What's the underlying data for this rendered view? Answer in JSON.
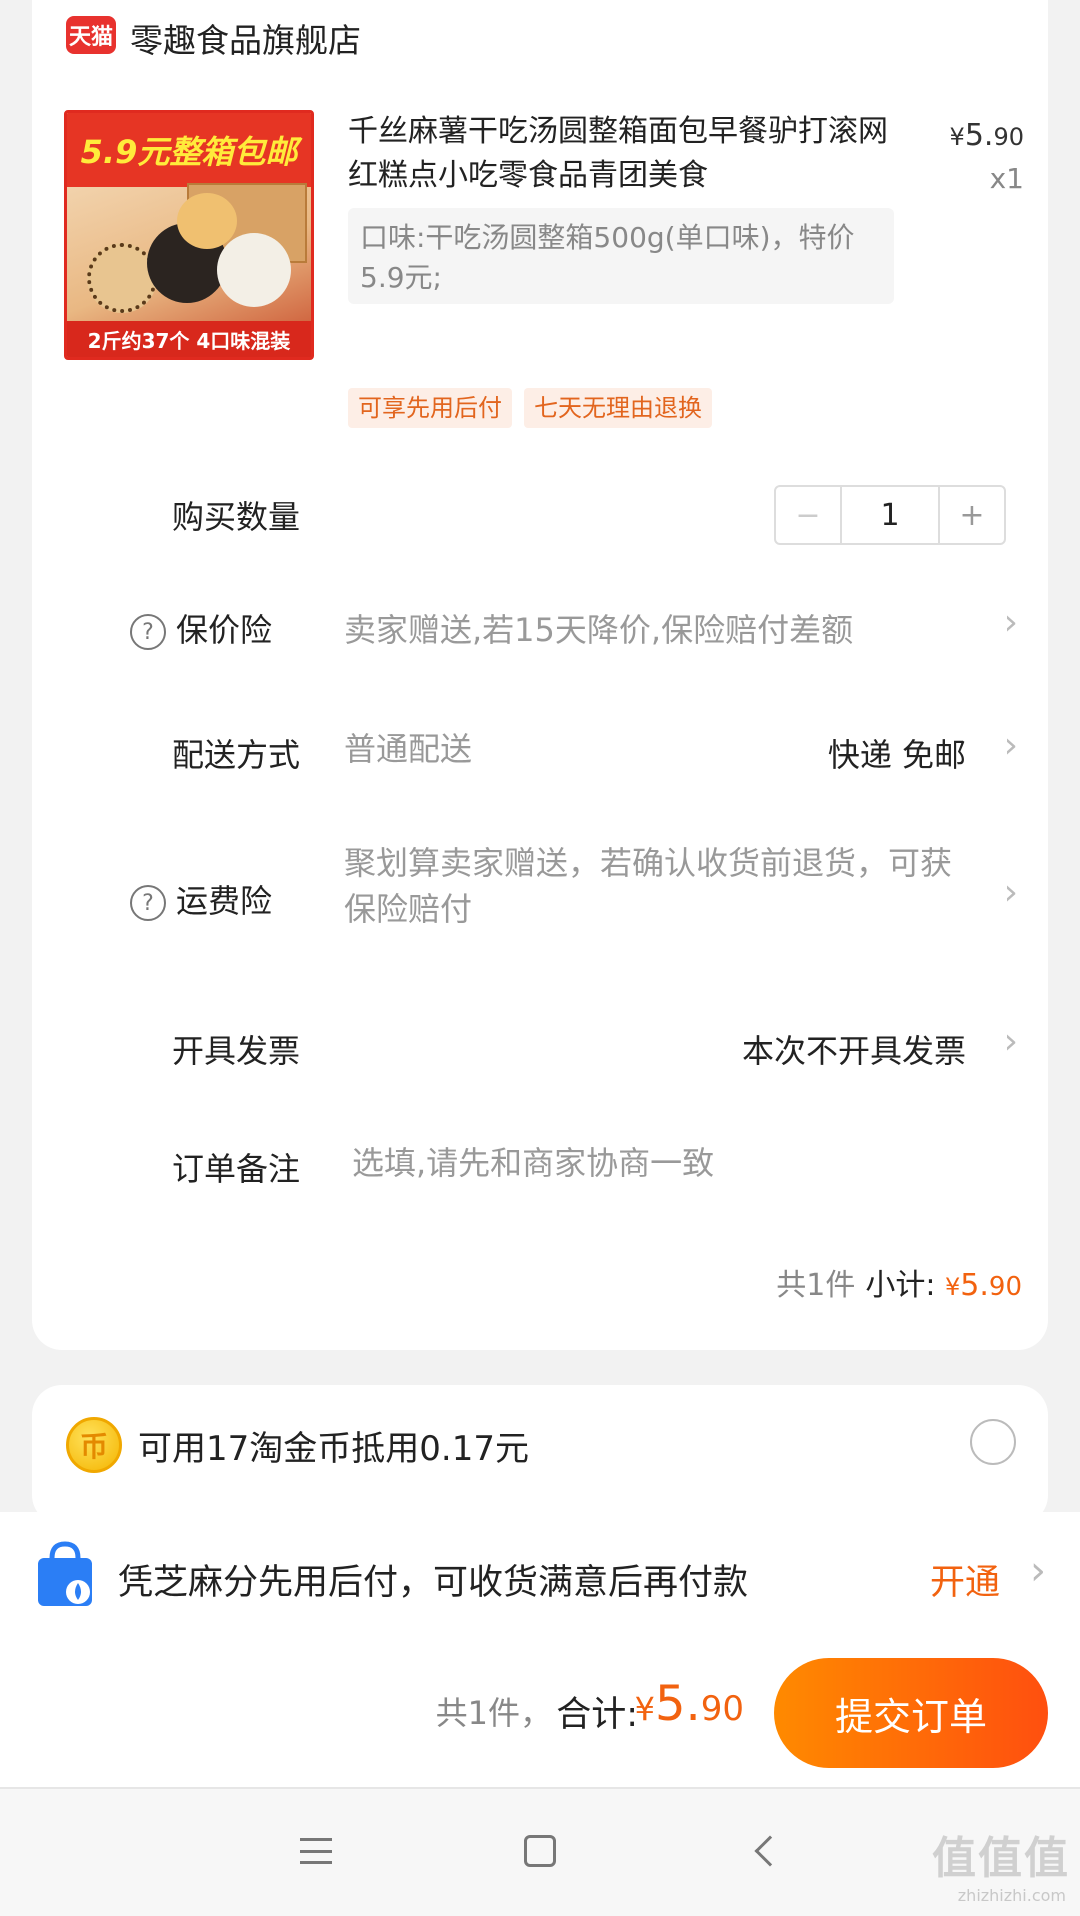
{
  "store": {
    "logo_text": "天猫",
    "name": "零趣食品旗舰店"
  },
  "product": {
    "image_banner": "5.9元整箱包邮",
    "image_footer": "2斤约37个 4口味混装",
    "title": "千丝麻薯干吃汤圆整箱面包早餐驴打滚网红糕点小吃零食品青团美食",
    "price_symbol": "¥",
    "price_int": "5.",
    "price_dec": "90",
    "quantity_text": "x1",
    "sku": "口味:干吃汤圆整箱500g(单口味)，特价5.9元;",
    "tags": [
      "可享先用后付",
      "七天无理由退换"
    ]
  },
  "rows": {
    "quantity_label": "购买数量",
    "quantity_value": "1",
    "minus": "−",
    "plus": "+",
    "price_protect_label": "保价险",
    "price_protect_value": "卖家赠送,若15天降价,保险赔付差额",
    "delivery_label": "配送方式",
    "delivery_value": "普通配送",
    "delivery_right": "快递 免邮",
    "shipping_ins_label": "运费险",
    "shipping_ins_value": "聚划算卖家赠送，若确认收货前退货，可获保险赔付",
    "invoice_label": "开具发票",
    "invoice_right": "本次不开具发票",
    "note_label": "订单备注",
    "note_placeholder": "选填,请先和商家协商一致",
    "help_glyph": "?"
  },
  "subtotal": {
    "count": "共1件",
    "label": "小计:",
    "symbol": "¥",
    "value_int": "5.",
    "value_dec": "90"
  },
  "coins": {
    "icon_glyph": "币",
    "text": "可用17淘金币抵用0.17元"
  },
  "paylater": {
    "text": "凭芝麻分先用后付，可收货满意后再付款",
    "action": "开通"
  },
  "summary": {
    "count": "共1件，",
    "label": "合计:",
    "symbol": "¥",
    "value_int": "5.",
    "value_dec": "90",
    "submit": "提交订单"
  },
  "chevron": "›",
  "watermark": {
    "main": "值值值",
    "sub": "zhizhizhi.com"
  },
  "colors": {
    "accent": "#f2620f",
    "tmall_red": "#e8322e",
    "tag_bg": "#fdeee6",
    "background": "#f2f2f2"
  }
}
